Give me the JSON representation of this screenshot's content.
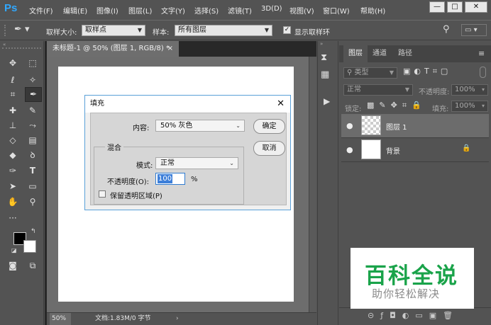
{
  "app": {
    "logo": "Ps"
  },
  "menu": [
    "文件(F)",
    "编辑(E)",
    "图像(I)",
    "图层(L)",
    "文字(Y)",
    "选择(S)",
    "滤镜(T)",
    "3D(D)",
    "视图(V)",
    "窗口(W)",
    "帮助(H)"
  ],
  "window_buttons": {
    "minimize": "—",
    "maximize": "□",
    "close": "✕"
  },
  "options": {
    "sample_size_label": "取样大小:",
    "sample_size_value": "取样点",
    "sample_label": "样本:",
    "sample_value": "所有图层",
    "show_ring_label": "显示取样环"
  },
  "document": {
    "tab_title": "未标题-1 @ 50% (图层 1, RGB/8) *",
    "tab_close": "×",
    "zoom": "50%",
    "doc_info": "文档:1.83M/0 字节"
  },
  "layers_panel": {
    "tabs": [
      "图层",
      "通道",
      "路径"
    ],
    "filter_label": "类型",
    "blend_mode": "正常",
    "opacity_label": "不透明度:",
    "opacity_value": "100%",
    "lock_label": "锁定:",
    "fill_label": "填充:",
    "fill_value": "100%",
    "layers": [
      {
        "name": "图层 1",
        "selected": true,
        "transparent": true
      },
      {
        "name": "背景",
        "selected": false,
        "locked": true
      }
    ]
  },
  "fill_dialog": {
    "title": "填充",
    "content_label": "内容:",
    "content_value": "50% 灰色",
    "ok_label": "确定",
    "cancel_label": "取消",
    "blending_group": "混合",
    "mode_label": "模式:",
    "mode_value": "正常",
    "opacity_label": "不透明度(O):",
    "opacity_value": "100",
    "opacity_unit": "%",
    "preserve_label": "保留透明区域(P)"
  },
  "watermark": {
    "line1": "百科全说",
    "line2": "助你轻松解决"
  },
  "colors": {
    "accent": "#31a8ff",
    "watermark_green": "#1aa34a",
    "ui_dark": "#535353",
    "foreground": "#000000",
    "background": "#ffffff"
  }
}
